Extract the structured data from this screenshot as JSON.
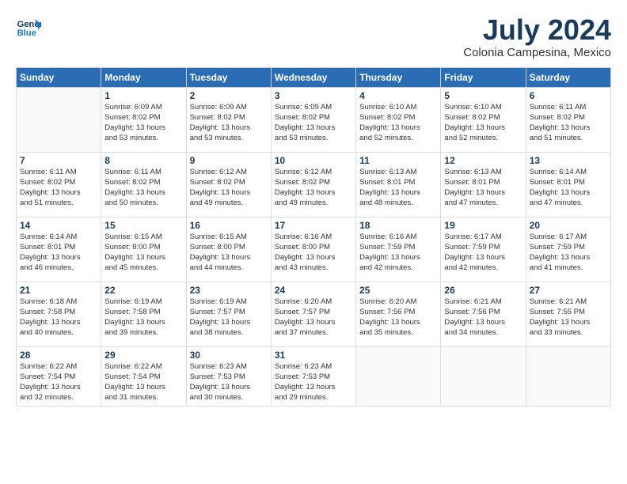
{
  "header": {
    "logo_general": "General",
    "logo_blue": "Blue",
    "month_title": "July 2024",
    "location": "Colonia Campesina, Mexico"
  },
  "columns": [
    "Sunday",
    "Monday",
    "Tuesday",
    "Wednesday",
    "Thursday",
    "Friday",
    "Saturday"
  ],
  "weeks": [
    [
      {
        "day": "",
        "info": ""
      },
      {
        "day": "1",
        "info": "Sunrise: 6:09 AM\nSunset: 8:02 PM\nDaylight: 13 hours\nand 53 minutes."
      },
      {
        "day": "2",
        "info": "Sunrise: 6:09 AM\nSunset: 8:02 PM\nDaylight: 13 hours\nand 53 minutes."
      },
      {
        "day": "3",
        "info": "Sunrise: 6:09 AM\nSunset: 8:02 PM\nDaylight: 13 hours\nand 53 minutes."
      },
      {
        "day": "4",
        "info": "Sunrise: 6:10 AM\nSunset: 8:02 PM\nDaylight: 13 hours\nand 52 minutes."
      },
      {
        "day": "5",
        "info": "Sunrise: 6:10 AM\nSunset: 8:02 PM\nDaylight: 13 hours\nand 52 minutes."
      },
      {
        "day": "6",
        "info": "Sunrise: 6:11 AM\nSunset: 8:02 PM\nDaylight: 13 hours\nand 51 minutes."
      }
    ],
    [
      {
        "day": "7",
        "info": "Sunrise: 6:11 AM\nSunset: 8:02 PM\nDaylight: 13 hours\nand 51 minutes."
      },
      {
        "day": "8",
        "info": "Sunrise: 6:11 AM\nSunset: 8:02 PM\nDaylight: 13 hours\nand 50 minutes."
      },
      {
        "day": "9",
        "info": "Sunrise: 6:12 AM\nSunset: 8:02 PM\nDaylight: 13 hours\nand 49 minutes."
      },
      {
        "day": "10",
        "info": "Sunrise: 6:12 AM\nSunset: 8:02 PM\nDaylight: 13 hours\nand 49 minutes."
      },
      {
        "day": "11",
        "info": "Sunrise: 6:13 AM\nSunset: 8:01 PM\nDaylight: 13 hours\nand 48 minutes."
      },
      {
        "day": "12",
        "info": "Sunrise: 6:13 AM\nSunset: 8:01 PM\nDaylight: 13 hours\nand 47 minutes."
      },
      {
        "day": "13",
        "info": "Sunrise: 6:14 AM\nSunset: 8:01 PM\nDaylight: 13 hours\nand 47 minutes."
      }
    ],
    [
      {
        "day": "14",
        "info": "Sunrise: 6:14 AM\nSunset: 8:01 PM\nDaylight: 13 hours\nand 46 minutes."
      },
      {
        "day": "15",
        "info": "Sunrise: 6:15 AM\nSunset: 8:00 PM\nDaylight: 13 hours\nand 45 minutes."
      },
      {
        "day": "16",
        "info": "Sunrise: 6:15 AM\nSunset: 8:00 PM\nDaylight: 13 hours\nand 44 minutes."
      },
      {
        "day": "17",
        "info": "Sunrise: 6:16 AM\nSunset: 8:00 PM\nDaylight: 13 hours\nand 43 minutes."
      },
      {
        "day": "18",
        "info": "Sunrise: 6:16 AM\nSunset: 7:59 PM\nDaylight: 13 hours\nand 42 minutes."
      },
      {
        "day": "19",
        "info": "Sunrise: 6:17 AM\nSunset: 7:59 PM\nDaylight: 13 hours\nand 42 minutes."
      },
      {
        "day": "20",
        "info": "Sunrise: 6:17 AM\nSunset: 7:59 PM\nDaylight: 13 hours\nand 41 minutes."
      }
    ],
    [
      {
        "day": "21",
        "info": "Sunrise: 6:18 AM\nSunset: 7:58 PM\nDaylight: 13 hours\nand 40 minutes."
      },
      {
        "day": "22",
        "info": "Sunrise: 6:19 AM\nSunset: 7:58 PM\nDaylight: 13 hours\nand 39 minutes."
      },
      {
        "day": "23",
        "info": "Sunrise: 6:19 AM\nSunset: 7:57 PM\nDaylight: 13 hours\nand 38 minutes."
      },
      {
        "day": "24",
        "info": "Sunrise: 6:20 AM\nSunset: 7:57 PM\nDaylight: 13 hours\nand 37 minutes."
      },
      {
        "day": "25",
        "info": "Sunrise: 6:20 AM\nSunset: 7:56 PM\nDaylight: 13 hours\nand 35 minutes."
      },
      {
        "day": "26",
        "info": "Sunrise: 6:21 AM\nSunset: 7:56 PM\nDaylight: 13 hours\nand 34 minutes."
      },
      {
        "day": "27",
        "info": "Sunrise: 6:21 AM\nSunset: 7:55 PM\nDaylight: 13 hours\nand 33 minutes."
      }
    ],
    [
      {
        "day": "28",
        "info": "Sunrise: 6:22 AM\nSunset: 7:54 PM\nDaylight: 13 hours\nand 32 minutes."
      },
      {
        "day": "29",
        "info": "Sunrise: 6:22 AM\nSunset: 7:54 PM\nDaylight: 13 hours\nand 31 minutes."
      },
      {
        "day": "30",
        "info": "Sunrise: 6:23 AM\nSunset: 7:53 PM\nDaylight: 13 hours\nand 30 minutes."
      },
      {
        "day": "31",
        "info": "Sunrise: 6:23 AM\nSunset: 7:53 PM\nDaylight: 13 hours\nand 29 minutes."
      },
      {
        "day": "",
        "info": ""
      },
      {
        "day": "",
        "info": ""
      },
      {
        "day": "",
        "info": ""
      }
    ]
  ]
}
